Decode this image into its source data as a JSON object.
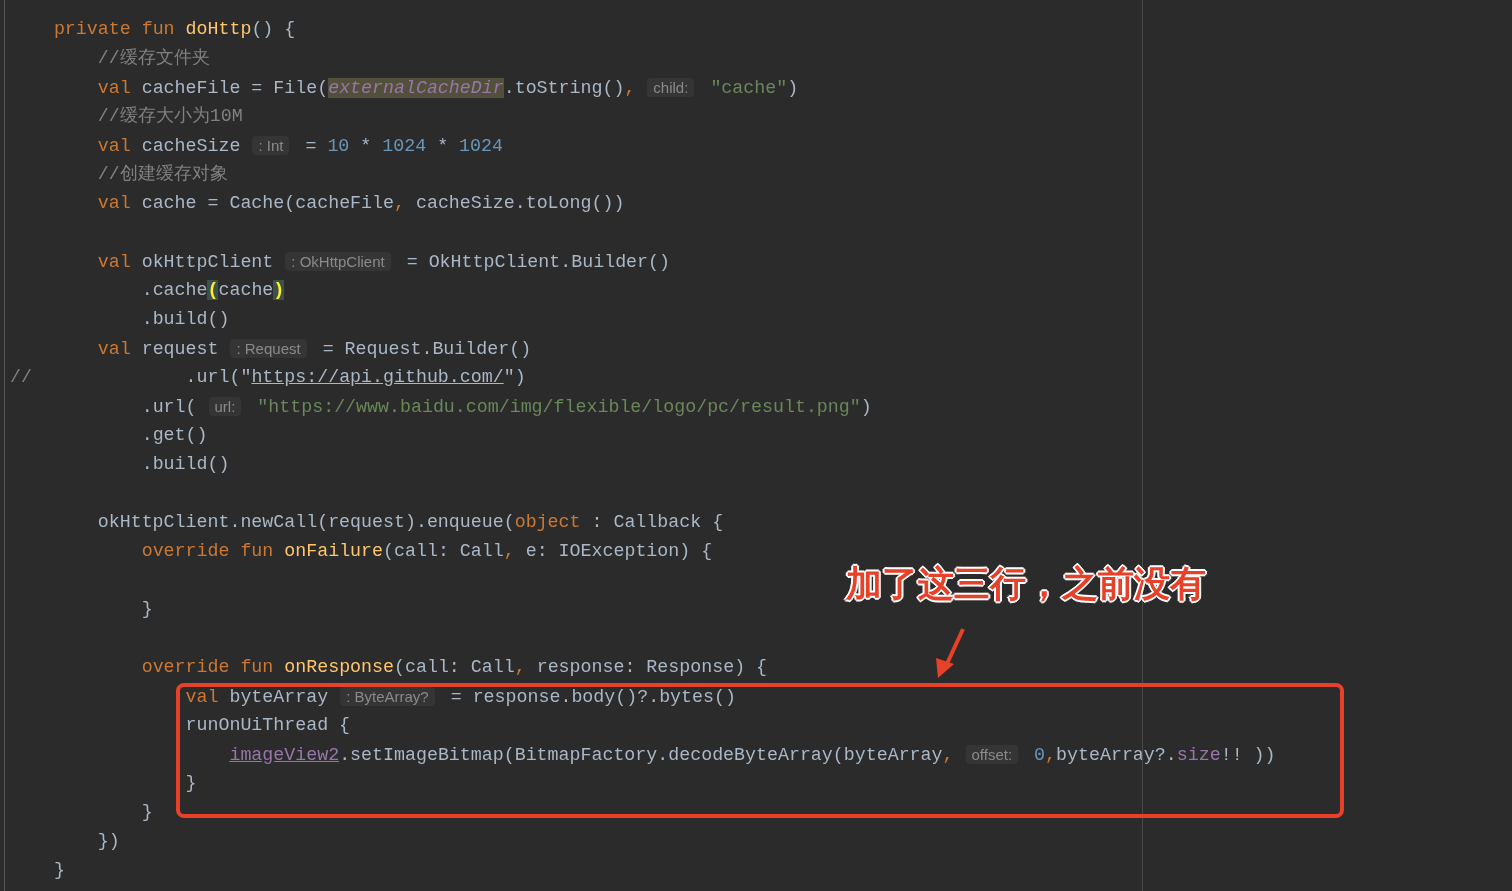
{
  "editor": {
    "lines": [
      {
        "kind": "code",
        "tokens": [
          {
            "kind": "keyword",
            "text": "    private fun "
          },
          {
            "kind": "function",
            "text": "doHttp"
          },
          {
            "kind": "plain",
            "text": "() {"
          }
        ]
      },
      {
        "kind": "code",
        "tokens": [
          {
            "kind": "comment",
            "text": "        //缓存文件夹"
          }
        ]
      },
      {
        "kind": "code",
        "tokens": [
          {
            "kind": "keyword",
            "text": "        val "
          },
          {
            "kind": "plain",
            "text": "cacheFile = File("
          },
          {
            "kind": "field",
            "text": "externalCacheDir"
          },
          {
            "kind": "plain",
            "text": ".toString()"
          },
          {
            "kind": "keyword",
            "text": ","
          },
          {
            "kind": "hint",
            "text": "child:"
          },
          {
            "kind": "string",
            "text": "\"cache\""
          },
          {
            "kind": "plain",
            "text": ")"
          }
        ]
      },
      {
        "kind": "code",
        "tokens": [
          {
            "kind": "comment",
            "text": "        //缓存大小为10M"
          }
        ]
      },
      {
        "kind": "code",
        "tokens": [
          {
            "kind": "keyword",
            "text": "        val "
          },
          {
            "kind": "plain",
            "text": "cacheSize"
          },
          {
            "kind": "hint",
            "text": ": Int"
          },
          {
            "kind": "plain",
            "text": "= "
          },
          {
            "kind": "number",
            "text": "10"
          },
          {
            "kind": "plain",
            "text": " * "
          },
          {
            "kind": "number",
            "text": "1024"
          },
          {
            "kind": "plain",
            "text": " * "
          },
          {
            "kind": "number",
            "text": "1024"
          }
        ]
      },
      {
        "kind": "code",
        "tokens": [
          {
            "kind": "comment",
            "text": "        //创建缓存对象"
          }
        ]
      },
      {
        "kind": "code",
        "tokens": [
          {
            "kind": "keyword",
            "text": "        val "
          },
          {
            "kind": "plain",
            "text": "cache = Cache(cacheFile"
          },
          {
            "kind": "keyword",
            "text": ","
          },
          {
            "kind": "plain",
            "text": " cacheSize.toLong())"
          }
        ]
      },
      {
        "kind": "blank"
      },
      {
        "kind": "code",
        "tokens": [
          {
            "kind": "keyword",
            "text": "        val "
          },
          {
            "kind": "plain",
            "text": "okHttpClient"
          },
          {
            "kind": "hint",
            "text": ": OkHttpClient"
          },
          {
            "kind": "plain",
            "text": "= OkHttpClient.Builder()"
          }
        ]
      },
      {
        "kind": "code",
        "tokens": [
          {
            "kind": "plain",
            "text": "            .cache"
          },
          {
            "kind": "brace",
            "text": "("
          },
          {
            "kind": "plain",
            "text": "cache"
          },
          {
            "kind": "brace",
            "text": ")"
          }
        ]
      },
      {
        "kind": "code",
        "tokens": [
          {
            "kind": "plain",
            "text": "            .build()"
          }
        ]
      },
      {
        "kind": "code",
        "tokens": [
          {
            "kind": "keyword",
            "text": "        val "
          },
          {
            "kind": "plain",
            "text": "request"
          },
          {
            "kind": "hint",
            "text": ": Request"
          },
          {
            "kind": "plain",
            "text": "= Request.Builder()"
          }
        ]
      },
      {
        "kind": "code",
        "tokens": [
          {
            "kind": "comment",
            "text": "//"
          },
          {
            "kind": "plain",
            "text": "              .url(\""
          },
          {
            "kind": "link",
            "text": "https://api.github.com/"
          },
          {
            "kind": "plain",
            "text": "\")"
          }
        ]
      },
      {
        "kind": "code",
        "tokens": [
          {
            "kind": "plain",
            "text": "            .url("
          },
          {
            "kind": "hint",
            "text": "url:"
          },
          {
            "kind": "string",
            "text": "\"https://www.baidu.com/img/flexible/logo/pc/result.png\""
          },
          {
            "kind": "plain",
            "text": ")"
          }
        ]
      },
      {
        "kind": "code",
        "tokens": [
          {
            "kind": "plain",
            "text": "            .get()"
          }
        ]
      },
      {
        "kind": "code",
        "tokens": [
          {
            "kind": "plain",
            "text": "            .build()"
          }
        ]
      },
      {
        "kind": "blank"
      },
      {
        "kind": "code",
        "tokens": [
          {
            "kind": "plain",
            "text": "        okHttpClient.newCall(request).enqueue("
          },
          {
            "kind": "keyword",
            "text": "object"
          },
          {
            "kind": "plain",
            "text": " : Callback {"
          }
        ]
      },
      {
        "kind": "code",
        "tokens": [
          {
            "kind": "keyword",
            "text": "            override fun "
          },
          {
            "kind": "function",
            "text": "onFailure"
          },
          {
            "kind": "plain",
            "text": "(call: Call"
          },
          {
            "kind": "keyword",
            "text": ","
          },
          {
            "kind": "plain",
            "text": " e: IOException) {"
          }
        ]
      },
      {
        "kind": "blank"
      },
      {
        "kind": "code",
        "tokens": [
          {
            "kind": "plain",
            "text": "            }"
          }
        ]
      },
      {
        "kind": "blank"
      },
      {
        "kind": "code",
        "tokens": [
          {
            "kind": "keyword",
            "text": "            override fun "
          },
          {
            "kind": "function",
            "text": "onResponse"
          },
          {
            "kind": "plain",
            "text": "(call: Call"
          },
          {
            "kind": "keyword",
            "text": ","
          },
          {
            "kind": "plain",
            "text": " response: Response) {"
          }
        ]
      },
      {
        "kind": "code",
        "tokens": [
          {
            "kind": "keyword",
            "text": "                val "
          },
          {
            "kind": "plain",
            "text": "byteArray"
          },
          {
            "kind": "hint",
            "text": ": ByteArray?"
          },
          {
            "kind": "plain",
            "text": "= response.body()?.bytes()"
          }
        ]
      },
      {
        "kind": "code",
        "tokens": [
          {
            "kind": "plain",
            "text": "                runOnUiThread {"
          }
        ]
      },
      {
        "kind": "code",
        "tokens": [
          {
            "kind": "member",
            "text": "                    imageView2"
          },
          {
            "kind": "plain",
            "text": ".setImageBitmap(BitmapFactory.decodeByteArray(byteArray"
          },
          {
            "kind": "keyword",
            "text": ","
          },
          {
            "kind": "hint",
            "text": "offset:"
          },
          {
            "kind": "number",
            "text": "0"
          },
          {
            "kind": "keyword",
            "text": ","
          },
          {
            "kind": "plain",
            "text": "byteArray?."
          },
          {
            "kind": "property",
            "text": "size"
          },
          {
            "kind": "plain",
            "text": "!! ))"
          }
        ]
      },
      {
        "kind": "code",
        "tokens": [
          {
            "kind": "plain",
            "text": "                }"
          }
        ]
      },
      {
        "kind": "code",
        "tokens": [
          {
            "kind": "plain",
            "text": "            }"
          }
        ]
      },
      {
        "kind": "code",
        "tokens": [
          {
            "kind": "plain",
            "text": "        })"
          }
        ]
      },
      {
        "kind": "code",
        "tokens": [
          {
            "kind": "plain",
            "text": "    }"
          }
        ]
      }
    ]
  },
  "annotation": {
    "label": "加了这三行，之前没有"
  }
}
